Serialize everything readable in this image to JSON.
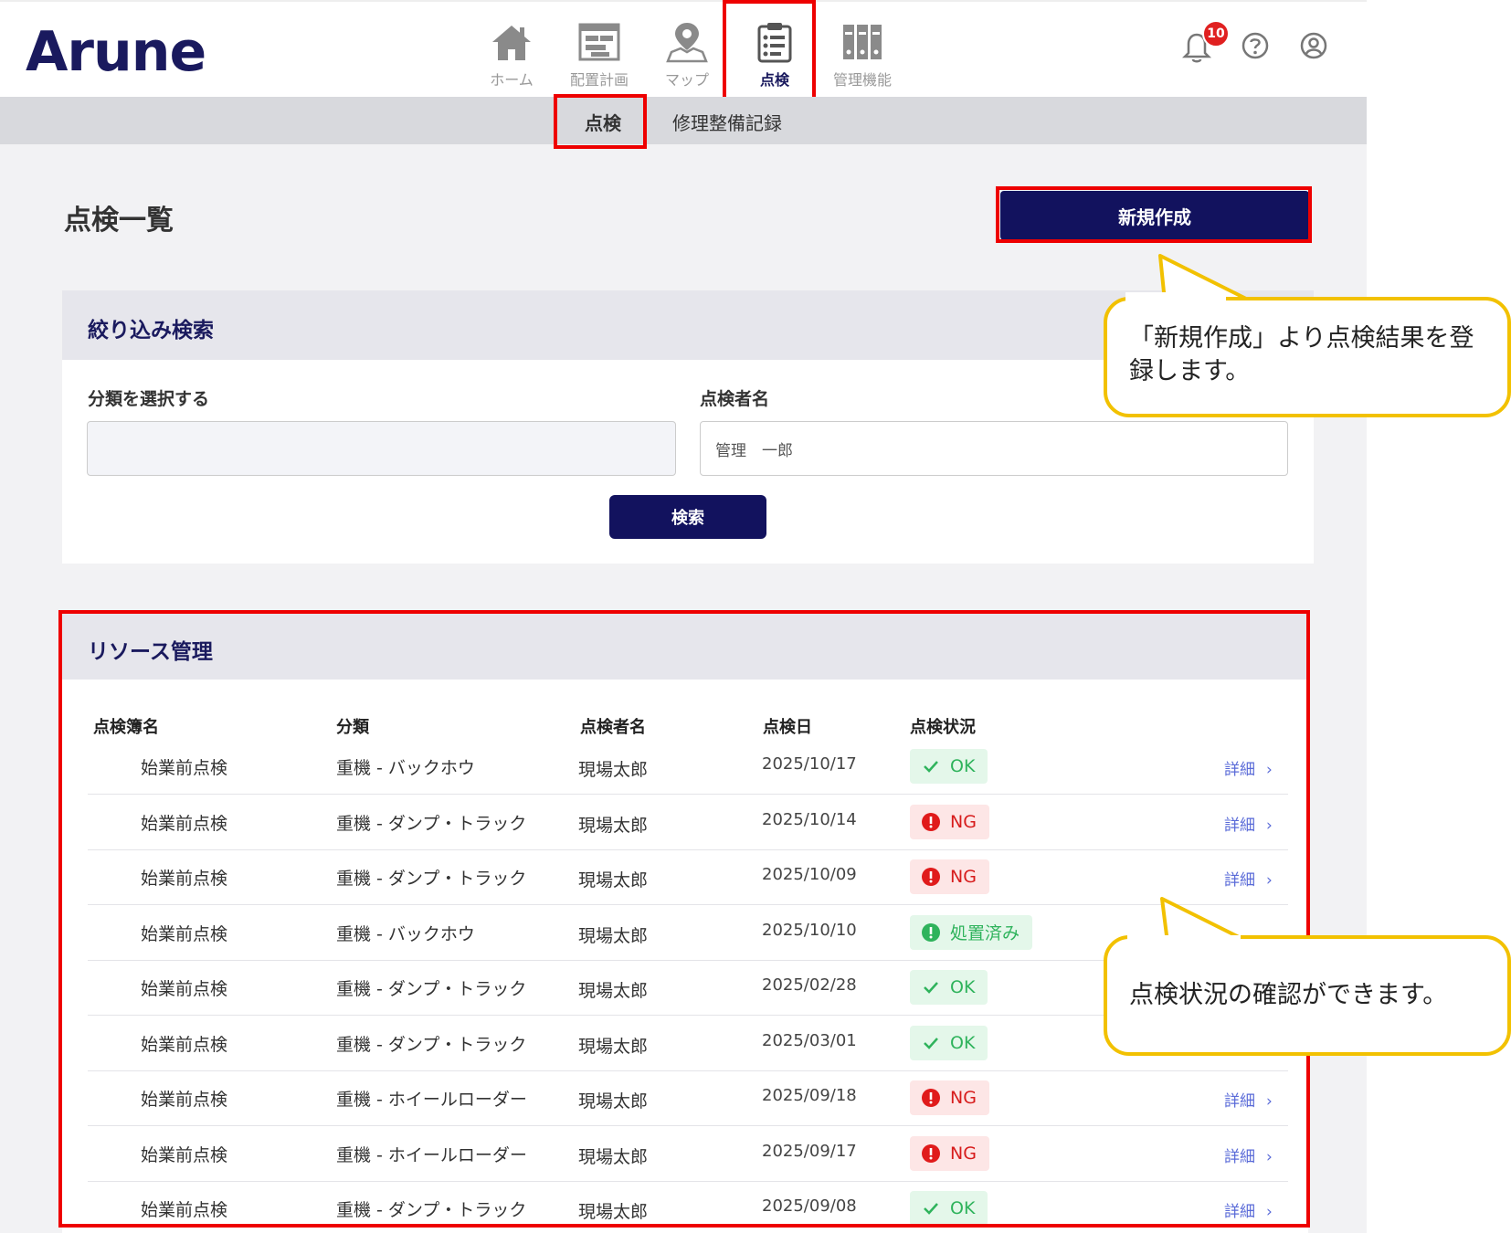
{
  "header": {
    "logo": "Arune",
    "nav": [
      {
        "label": "ホーム",
        "icon": "home-icon"
      },
      {
        "label": "配置計画",
        "icon": "layout-plan-icon"
      },
      {
        "label": "マップ",
        "icon": "map-pin-icon"
      },
      {
        "label": "点検",
        "icon": "clipboard-icon",
        "active": true
      },
      {
        "label": "管理機能",
        "icon": "binders-icon"
      }
    ],
    "notification_count": "10"
  },
  "subnav": {
    "tab1": "点検",
    "tab2": "修理整備記録"
  },
  "page": {
    "title": "点検一覧",
    "new_button": "新規作成"
  },
  "filter": {
    "title": "絞り込み検索",
    "category_label": "分類を選択する",
    "category_value": "",
    "inspector_label": "点検者名",
    "inspector_value": "管理　一郎",
    "search_button": "検索"
  },
  "resources": {
    "title": "リソース管理",
    "columns": [
      "点検簿名",
      "分類",
      "点検者名",
      "点検日",
      "点検状況"
    ],
    "detail_label": "詳細",
    "rows": [
      {
        "name": "始業前点検",
        "category": "重機 - バックホウ",
        "inspector": "現場太郎",
        "date": "2025/10/17",
        "status": "OK",
        "kind": "ok",
        "detail": true
      },
      {
        "name": "始業前点検",
        "category": "重機 - ダンプ・トラック",
        "inspector": "現場太郎",
        "date": "2025/10/14",
        "status": "NG",
        "kind": "ng",
        "detail": true
      },
      {
        "name": "始業前点検",
        "category": "重機 - ダンプ・トラック",
        "inspector": "現場太郎",
        "date": "2025/10/09",
        "status": "NG",
        "kind": "ng",
        "detail": true
      },
      {
        "name": "始業前点検",
        "category": "重機 - バックホウ",
        "inspector": "現場太郎",
        "date": "2025/10/10",
        "status": "処置済み",
        "kind": "done",
        "detail": false
      },
      {
        "name": "始業前点検",
        "category": "重機 - ダンプ・トラック",
        "inspector": "現場太郎",
        "date": "2025/02/28",
        "status": "OK",
        "kind": "ok",
        "detail": false
      },
      {
        "name": "始業前点検",
        "category": "重機 - ダンプ・トラック",
        "inspector": "現場太郎",
        "date": "2025/03/01",
        "status": "OK",
        "kind": "ok",
        "detail": false
      },
      {
        "name": "始業前点検",
        "category": "重機 - ホイールローダー",
        "inspector": "現場太郎",
        "date": "2025/09/18",
        "status": "NG",
        "kind": "ng",
        "detail": true
      },
      {
        "name": "始業前点検",
        "category": "重機 - ホイールローダー",
        "inspector": "現場太郎",
        "date": "2025/09/17",
        "status": "NG",
        "kind": "ng",
        "detail": true
      },
      {
        "name": "始業前点検",
        "category": "重機 - ダンプ・トラック",
        "inspector": "現場太郎",
        "date": "2025/09/08",
        "status": "OK",
        "kind": "ok",
        "detail": true
      }
    ]
  },
  "callouts": {
    "new_entry": "「新規作成」より点検結果を登録します。",
    "status_check": "点検状況の確認ができます。"
  },
  "colors": {
    "brand_navy": "#12125e",
    "highlight_red": "#e00000",
    "callout_yellow": "#f2c100",
    "ok_green": "#2fb35c",
    "ng_red": "#d71c1c"
  }
}
